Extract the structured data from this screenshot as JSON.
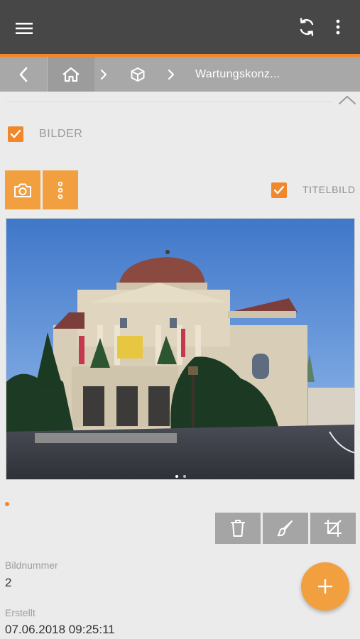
{
  "header": {
    "menu_icon": "hamburger-icon",
    "sync_icon": "sync-icon",
    "more_icon": "more-vertical-icon"
  },
  "breadcrumb": {
    "back_icon": "chevron-left-icon",
    "home_icon": "home-icon",
    "object_icon": "cube-icon",
    "current": "Wartungskonz..."
  },
  "section": {
    "title": "BILDER",
    "checked": true
  },
  "toolbar": {
    "camera_icon": "camera-icon",
    "options_icon": "more-vertical-icon",
    "titelbild_label": "TITELBILD",
    "titelbild_checked": true
  },
  "image": {
    "description_icon": "photo",
    "carousel_count": 2,
    "carousel_active": 1
  },
  "actions": {
    "delete_icon": "trash-icon",
    "edit_icon": "brush-icon",
    "crop_icon": "crop-icon"
  },
  "fields": [
    {
      "label": "Bildnummer",
      "value": "2"
    },
    {
      "label": "Erstellt",
      "value": "07.06.2018 09:25:11"
    }
  ],
  "fab": {
    "icon": "plus-icon"
  },
  "colors": {
    "accent": "#f2872a",
    "button_orange": "#f2a03f",
    "topbar": "#474747",
    "breadcrumb": "#a8a8a8",
    "action_gray": "#a5a5a5"
  }
}
